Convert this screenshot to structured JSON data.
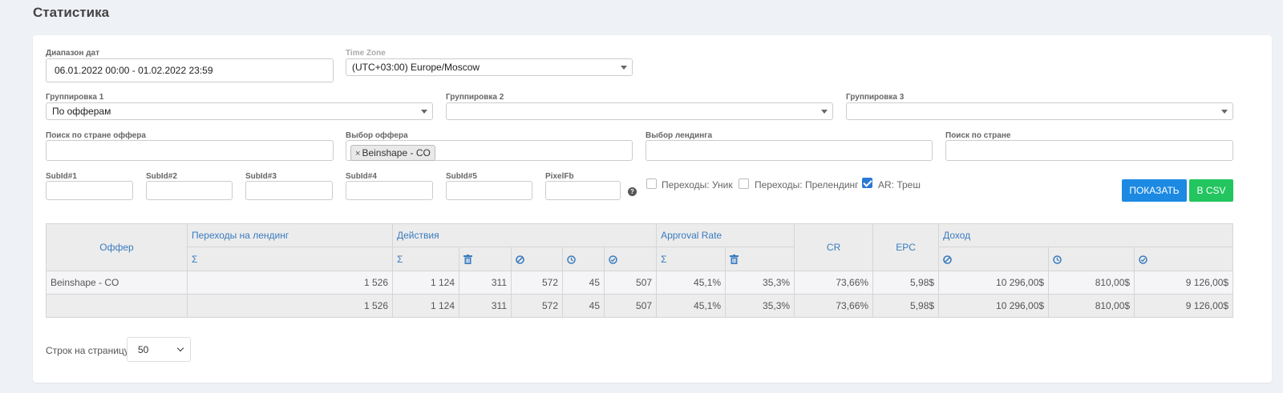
{
  "page": {
    "title": "Статистика"
  },
  "filters": {
    "date_range": {
      "label": "Диапазон дат",
      "value": "06.01.2022 00:00 - 01.02.2022 23:59"
    },
    "timezone": {
      "label": "Time Zone",
      "value": "(UTC+03:00) Europe/Moscow"
    },
    "group1": {
      "label": "Группировка 1",
      "value": "По офферам"
    },
    "group2": {
      "label": "Группировка 2",
      "value": ""
    },
    "group3": {
      "label": "Группировка 3",
      "value": ""
    },
    "offer_country": {
      "label": "Поиск по стране оффера",
      "value": ""
    },
    "offer_select": {
      "label": "Выбор оффера",
      "tag": "Beinshape - CO",
      "remove": "×"
    },
    "landing_select": {
      "label": "Выбор лендинга",
      "value": ""
    },
    "country_search": {
      "label": "Поиск по стране",
      "value": ""
    },
    "subids": [
      {
        "label": "SubId#1",
        "value": ""
      },
      {
        "label": "SubId#2",
        "value": ""
      },
      {
        "label": "SubId#3",
        "value": ""
      },
      {
        "label": "SubId#4",
        "value": ""
      },
      {
        "label": "SubId#5",
        "value": ""
      },
      {
        "label": "PixelFb",
        "value": ""
      }
    ],
    "help": "?",
    "checkboxes": [
      {
        "label": "Переходы: Уник",
        "checked": false
      },
      {
        "label": "Переходы: Прелендинг",
        "checked": false
      },
      {
        "label": "AR: Треш",
        "checked": true
      }
    ],
    "show_button": "ПОКАЗАТЬ",
    "csv_button": "В CSV"
  },
  "table": {
    "headers": {
      "offer": "Оффер",
      "landing_clicks": "Переходы на лендинг",
      "actions": "Действия",
      "approval_rate": "Approval Rate",
      "cr": "CR",
      "epc": "EPC",
      "income": "Доход",
      "sigma": "Σ"
    },
    "rows": [
      {
        "name": "Beinshape - CO",
        "cells": [
          "1 526",
          "1 124",
          "311",
          "572",
          "45",
          "507",
          "45,1%",
          "35,3%",
          "73,66%",
          "5,98$",
          "10 296,00$",
          "810,00$",
          "9 126,00$"
        ]
      }
    ],
    "total": {
      "name": "",
      "cells": [
        "1 526",
        "1 124",
        "311",
        "572",
        "45",
        "507",
        "45,1%",
        "35,3%",
        "73,66%",
        "5,98$",
        "10 296,00$",
        "810,00$",
        "9 126,00$"
      ]
    }
  },
  "pagination": {
    "label": "Строк на страницу:",
    "value": "50"
  },
  "colors": {
    "accent_blue": "#1c89e3",
    "accent_green": "#22c55e",
    "header_text": "#3a7bbf"
  }
}
